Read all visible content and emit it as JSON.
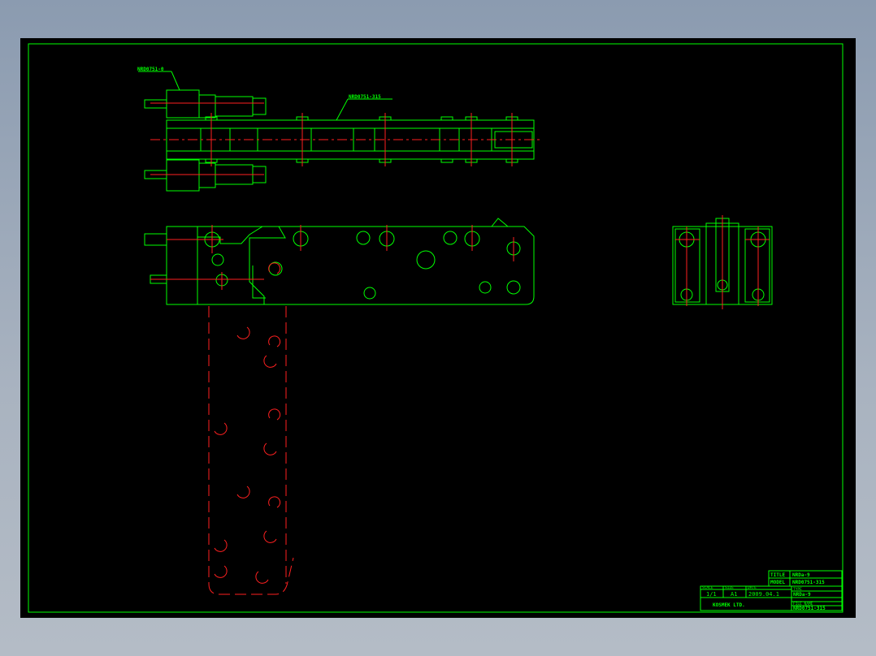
{
  "callouts": {
    "top_left": "NRD0751-0",
    "top_chain": "NRD0751-315"
  },
  "title_block": {
    "title_label": "TITLE",
    "title_value": "NRDa-9",
    "model_label": "MODEL",
    "model_value": "NRD0751-315",
    "scale_header": "SCALE",
    "scale_value": "1/1",
    "size_header": "SIZE",
    "size_value": "A1",
    "date_header": "DATE",
    "date_value": "2009.04.1",
    "type_header": "TYPE",
    "type_value": "NRDa-9",
    "file_header": "FILE NAME",
    "file_value": "NRD0751-315",
    "company": "KOSMEK LTD."
  },
  "colors": {
    "outline": "#00ff00",
    "centerline": "#ff2020",
    "sheet": "#000000"
  }
}
